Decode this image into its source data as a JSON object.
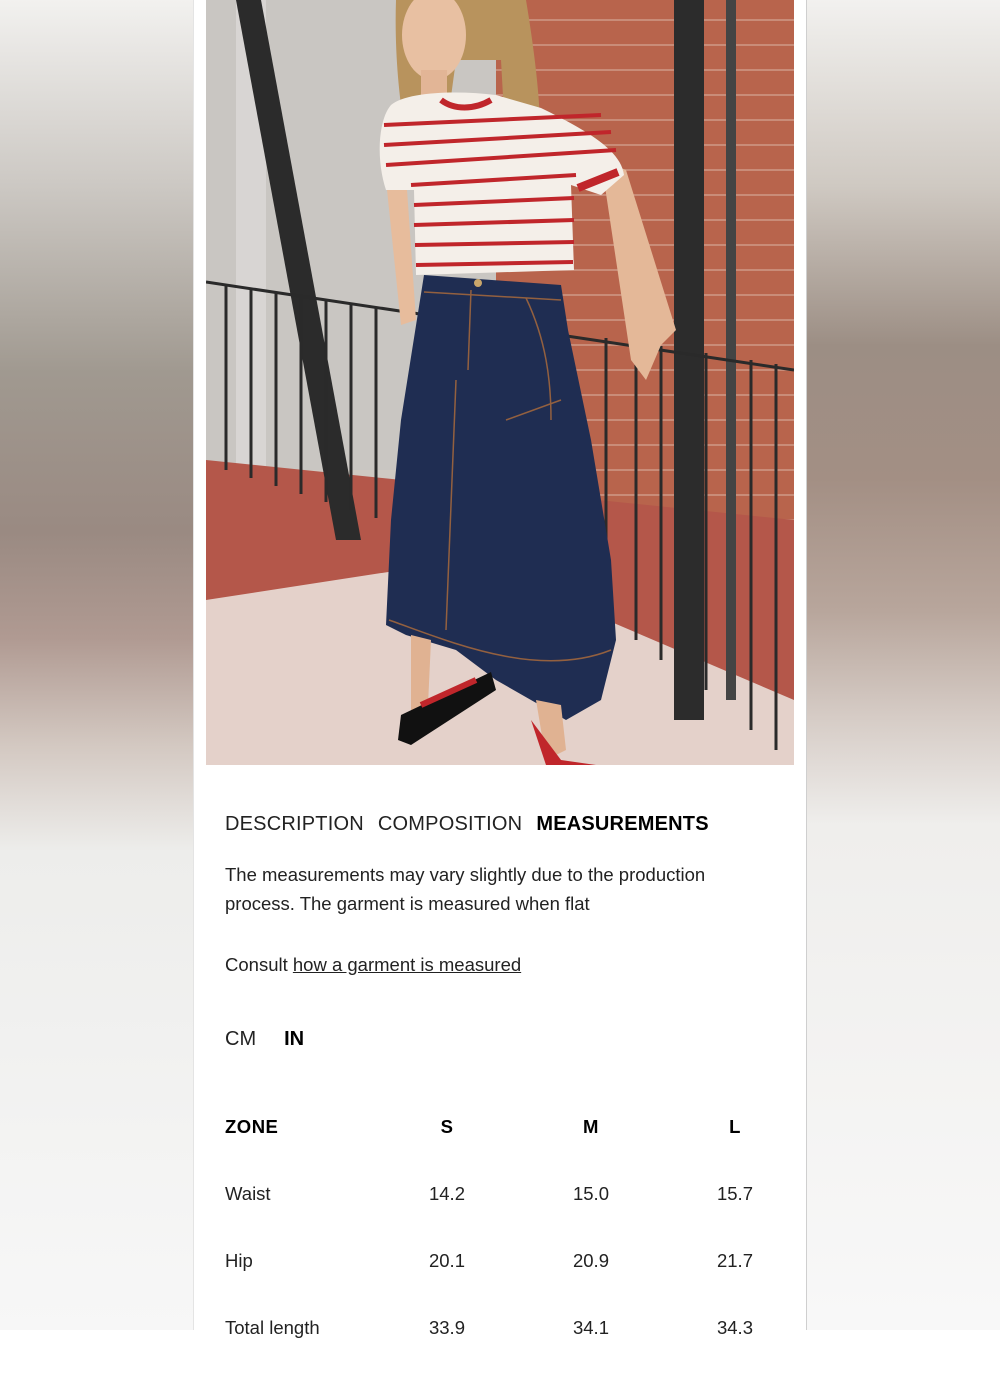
{
  "tabs": {
    "description": "DESCRIPTION",
    "composition": "COMPOSITION",
    "measurements": "MEASUREMENTS"
  },
  "measurements": {
    "note_line1": "The measurements may vary slightly due to the production",
    "note_line2": "process. The garment is measured when flat",
    "consult_prefix": "Consult ",
    "consult_link": "how a garment is measured"
  },
  "units": {
    "cm": "CM",
    "in": "IN",
    "selected": "IN"
  },
  "size_table": {
    "headers": [
      "ZONE",
      "S",
      "M",
      "L"
    ],
    "rows": [
      {
        "zone": "Waist",
        "values": [
          "14.2",
          "15.0",
          "15.7"
        ]
      },
      {
        "zone": "Hip",
        "values": [
          "20.1",
          "20.9",
          "21.7"
        ]
      },
      {
        "zone": "Total length",
        "values": [
          "33.9",
          "34.1",
          "34.3"
        ]
      }
    ]
  },
  "colors": {
    "denim": "#1f2d52",
    "stripe_red": "#c0262b",
    "brick": "#b5533e"
  }
}
